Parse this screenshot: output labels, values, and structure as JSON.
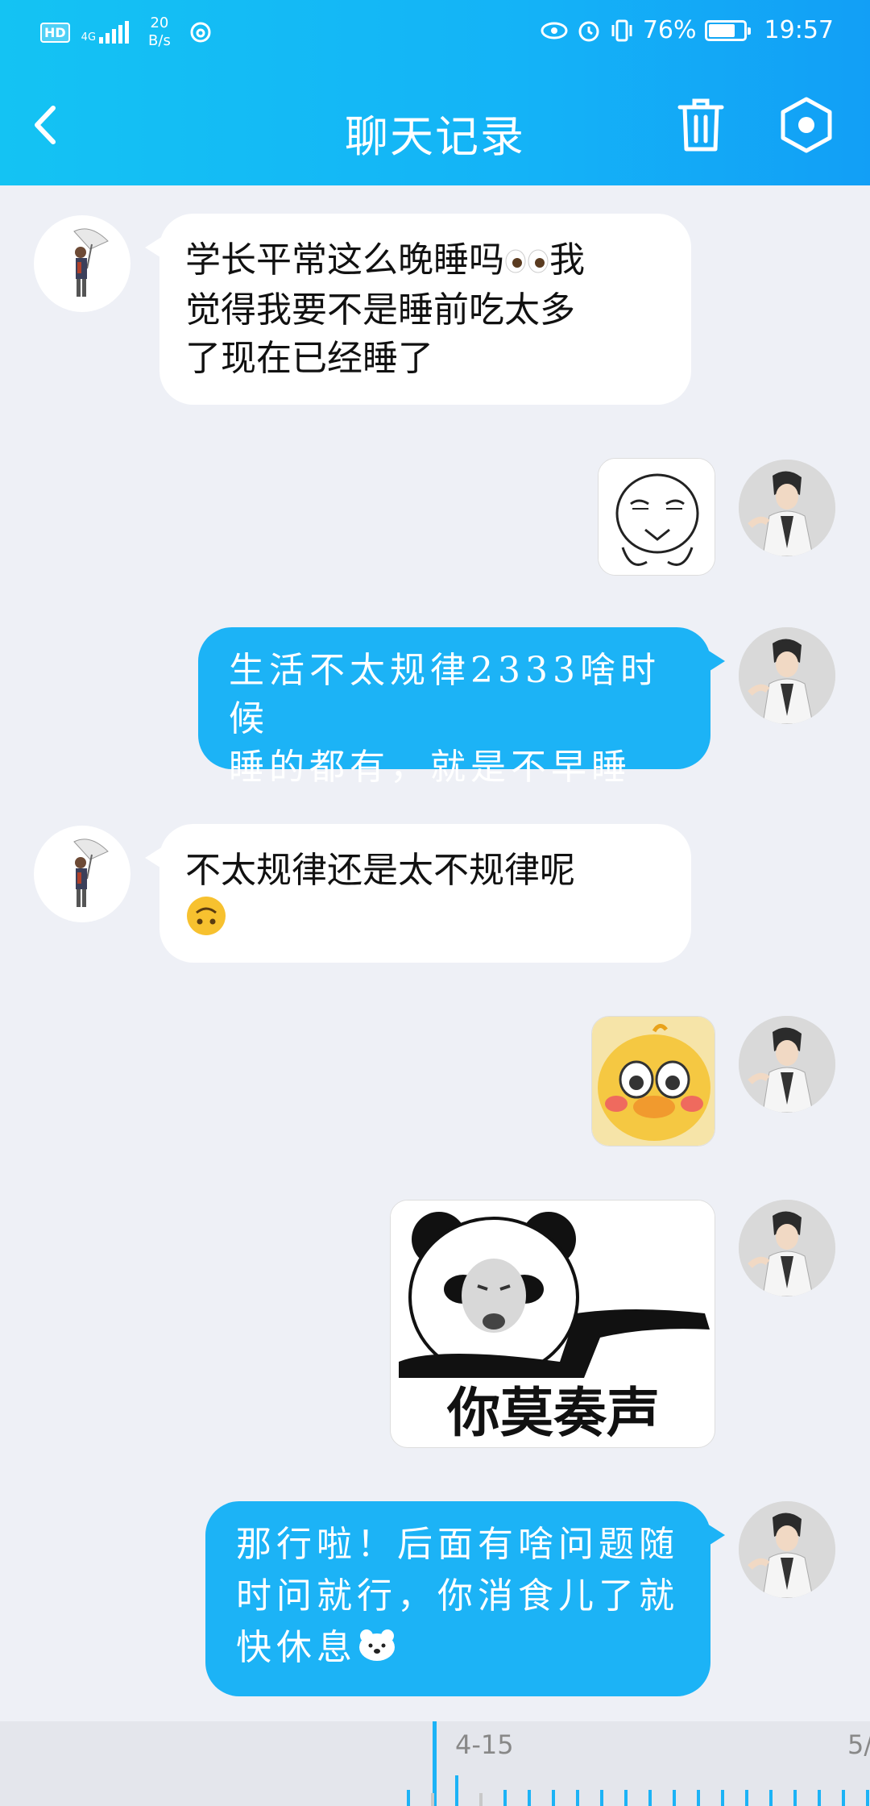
{
  "status_bar": {
    "hd_badge": "HD",
    "network_type": "4G",
    "speed_value": "20",
    "speed_unit": "B/s",
    "battery": "76%",
    "battery_level": 0.76,
    "time": "19:57"
  },
  "header": {
    "title": "聊天记录",
    "back_icon": "chevron-left-icon",
    "trash_icon": "trash-icon",
    "settings_icon": "hexagon-settings-icon"
  },
  "messages": [
    {
      "side": "left",
      "type": "text",
      "line1": "学长平常这么晚睡吗",
      "line1_tail": "我",
      "line2": "觉得我要不是睡前吃太多",
      "line3": "了现在已经睡了",
      "emoji": "eyes-emoji"
    },
    {
      "side": "right",
      "type": "sticker",
      "sticker": "doodle-face-sticker"
    },
    {
      "side": "right",
      "type": "text",
      "line1": "生活不太规律2333啥时候",
      "line2": "睡的都有，就是不早睡"
    },
    {
      "side": "left",
      "type": "text",
      "line1": "不太规律还是太不规律呢",
      "emoji": "upside-down-face-emoji"
    },
    {
      "side": "right",
      "type": "sticker",
      "sticker": "crying-duck-sticker"
    },
    {
      "side": "right",
      "type": "sticker",
      "sticker": "panda-meme-sticker",
      "caption": "你莫奏声"
    },
    {
      "side": "right",
      "type": "text",
      "line1": "那行啦！后面有啥问题随",
      "line2": "时问就行，你消食儿了就",
      "line3": "快休息",
      "emoji": "polar-bear-emoji"
    }
  ],
  "timeline": {
    "date": "4-15",
    "next_date": "5/"
  },
  "colors": {
    "header_blue": "#14b3f7",
    "bubble_blue": "#1cb3f6",
    "background": "#eef0f6"
  }
}
